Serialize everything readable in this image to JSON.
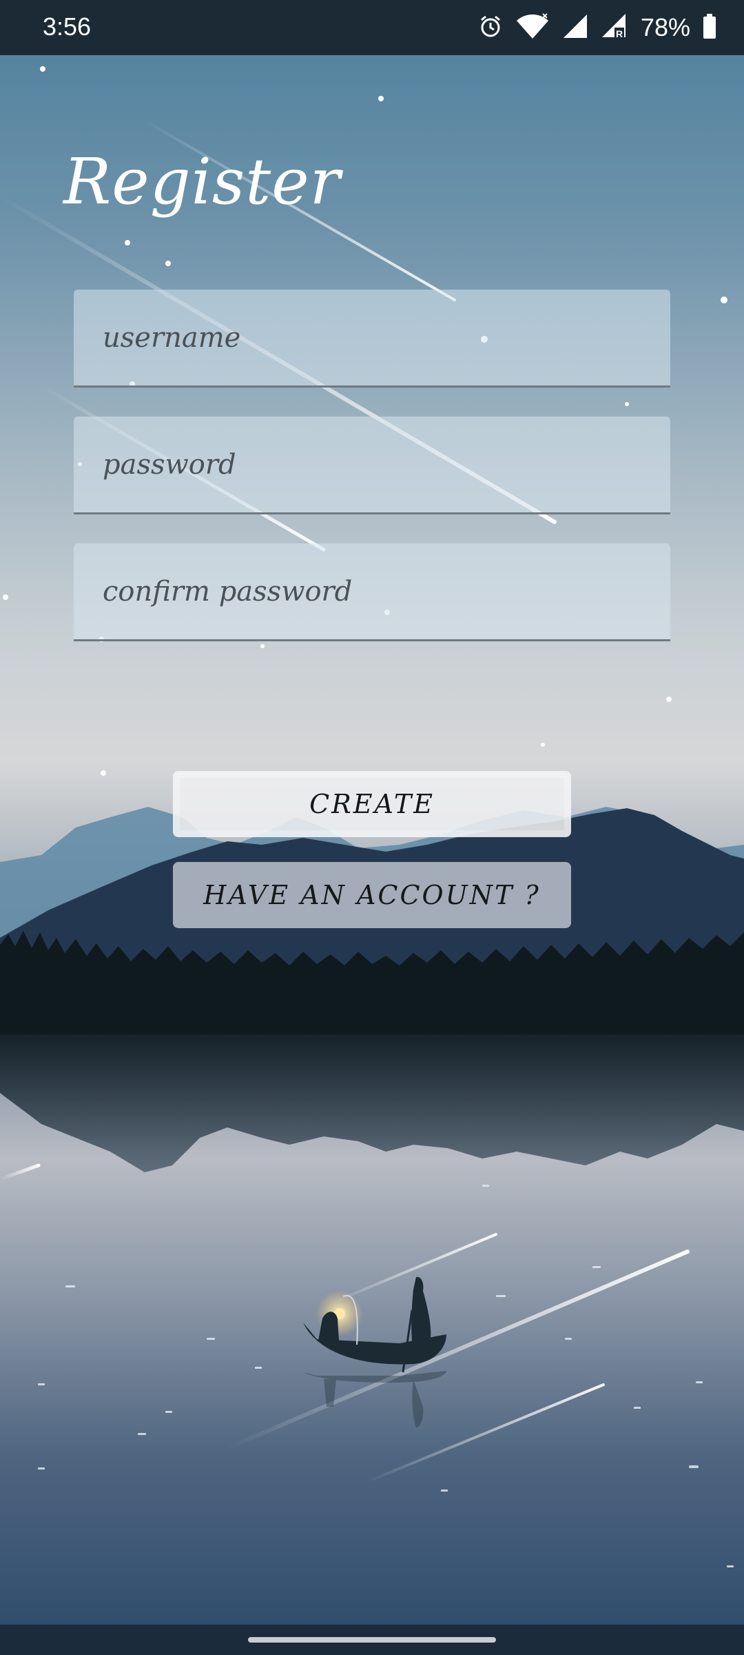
{
  "status_bar": {
    "time": "3:56",
    "battery_percent": "78%",
    "icons": [
      "alarm-icon",
      "wifi-icon",
      "signal-icon",
      "signal-roaming-icon",
      "battery-icon"
    ]
  },
  "page": {
    "title": "Register"
  },
  "form": {
    "username_placeholder": "username",
    "password_placeholder": "password",
    "confirm_password_placeholder": "confirm password",
    "username_value": "",
    "password_value": "",
    "confirm_password_value": ""
  },
  "actions": {
    "create_label": "CREATE",
    "have_account_label": "HAVE AN ACCOUNT ?"
  },
  "colors": {
    "title_text": "#ffffff",
    "field_background": "#d7e4ec",
    "button_text": "#15181b",
    "status_bar": "#1c2a35"
  }
}
